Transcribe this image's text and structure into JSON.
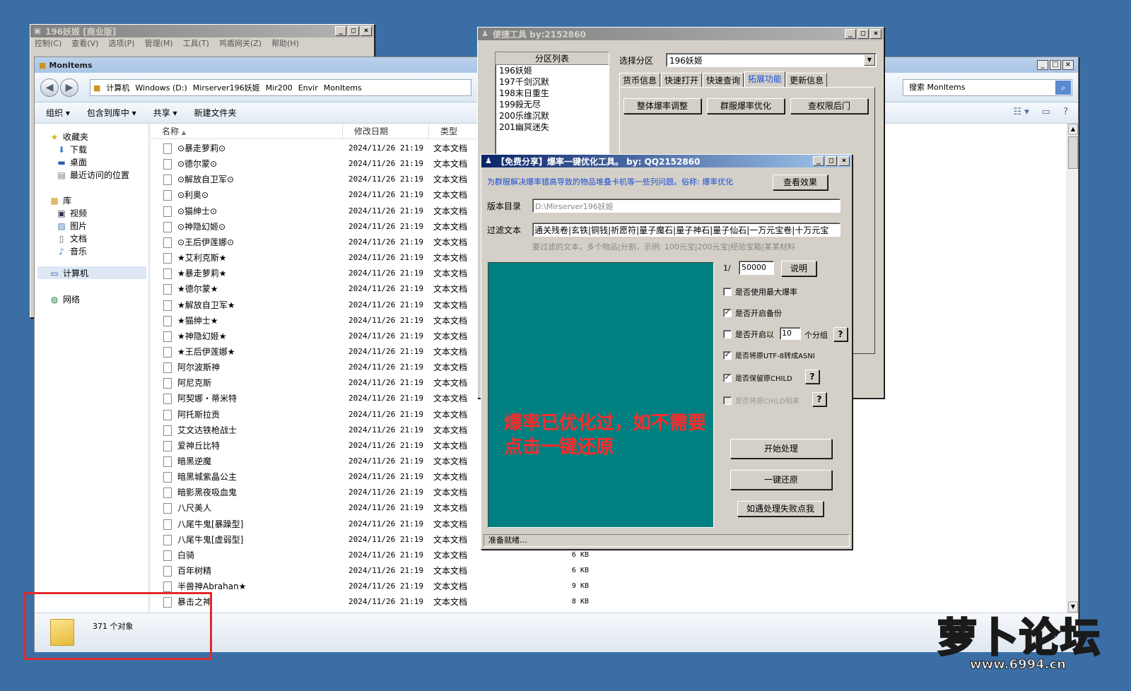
{
  "colors": {
    "desktop": "#3a6ea5",
    "teal_panel": "#008080",
    "alert_red": "#ff2a2a",
    "highlight_box": "#e02a2a",
    "tab_selected": "#1a4fd8",
    "logo_yellow": "#ffd21a"
  },
  "game_window": {
    "title": "196妖姬 [商业版]",
    "menu": [
      "控制(C)",
      "查看(V)",
      "选项(P)",
      "管理(M)",
      "工具(T)",
      "鸡盾网关(Z)",
      "帮助(H)"
    ]
  },
  "explorer": {
    "title": "MonItems",
    "breadcrumb": [
      "计算机",
      "Windows (D:)",
      "Mirserver196妖姬",
      "Mir200",
      "Envir",
      "MonItems"
    ],
    "search_placeholder": "搜索 MonItems",
    "commands": [
      "组织 ▾",
      "包含到库中 ▾",
      "共享 ▾",
      "新建文件夹"
    ],
    "nav": {
      "favorites": "收藏夹",
      "downloads": "下载",
      "desktop": "桌面",
      "recent": "最近访问的位置",
      "library": "库",
      "videos": "视频",
      "pictures": "图片",
      "documents": "文档",
      "music": "音乐",
      "computer": "计算机",
      "network": "网络"
    },
    "columns": {
      "name": "名称",
      "date": "修改日期",
      "type": "类型"
    },
    "files": [
      {
        "name": "⊙暴走萝莉⊙",
        "date": "2024/11/26 21:19",
        "type": "文本文档",
        "size": ""
      },
      {
        "name": "⊙德尔蒙⊙",
        "date": "2024/11/26 21:19",
        "type": "文本文档",
        "size": ""
      },
      {
        "name": "⊙解放自卫军⊙",
        "date": "2024/11/26 21:19",
        "type": "文本文档",
        "size": ""
      },
      {
        "name": "⊙利奥⊙",
        "date": "2024/11/26 21:19",
        "type": "文本文档",
        "size": ""
      },
      {
        "name": "⊙猫绅士⊙",
        "date": "2024/11/26 21:19",
        "type": "文本文档",
        "size": ""
      },
      {
        "name": "⊙神隐幻姬⊙",
        "date": "2024/11/26 21:19",
        "type": "文本文档",
        "size": ""
      },
      {
        "name": "⊙王后伊莲娜⊙",
        "date": "2024/11/26 21:19",
        "type": "文本文档",
        "size": ""
      },
      {
        "name": "★艾利克斯★",
        "date": "2024/11/26 21:19",
        "type": "文本文档",
        "size": ""
      },
      {
        "name": "★暴走萝莉★",
        "date": "2024/11/26 21:19",
        "type": "文本文档",
        "size": ""
      },
      {
        "name": "★德尔蒙★",
        "date": "2024/11/26 21:19",
        "type": "文本文档",
        "size": ""
      },
      {
        "name": "★解放自卫军★",
        "date": "2024/11/26 21:19",
        "type": "文本文档",
        "size": ""
      },
      {
        "name": "★猫绅士★",
        "date": "2024/11/26 21:19",
        "type": "文本文档",
        "size": ""
      },
      {
        "name": "★神隐幻姬★",
        "date": "2024/11/26 21:19",
        "type": "文本文档",
        "size": ""
      },
      {
        "name": "★王后伊莲娜★",
        "date": "2024/11/26 21:19",
        "type": "文本文档",
        "size": ""
      },
      {
        "name": "阿尔波斯神",
        "date": "2024/11/26 21:19",
        "type": "文本文档",
        "size": ""
      },
      {
        "name": "阿尼克斯",
        "date": "2024/11/26 21:19",
        "type": "文本文档",
        "size": ""
      },
      {
        "name": "阿契娜・蒂米特",
        "date": "2024/11/26 21:19",
        "type": "文本文档",
        "size": ""
      },
      {
        "name": "阿托斯拉贡",
        "date": "2024/11/26 21:19",
        "type": "文本文档",
        "size": ""
      },
      {
        "name": "艾文达铁枪战士",
        "date": "2024/11/26 21:19",
        "type": "文本文档",
        "size": ""
      },
      {
        "name": "爱神丘比特",
        "date": "2024/11/26 21:19",
        "type": "文本文档",
        "size": ""
      },
      {
        "name": "暗黑逆魔",
        "date": "2024/11/26 21:19",
        "type": "文本文档",
        "size": ""
      },
      {
        "name": "暗黑城紫晶公主",
        "date": "2024/11/26 21:19",
        "type": "文本文档",
        "size": ""
      },
      {
        "name": "暗影黑夜吸血鬼",
        "date": "2024/11/26 21:19",
        "type": "文本文档",
        "size": ""
      },
      {
        "name": "八尺美人",
        "date": "2024/11/26 21:19",
        "type": "文本文档",
        "size": ""
      },
      {
        "name": "八尾牛鬼[暴躁型]",
        "date": "2024/11/26 21:19",
        "type": "文本文档",
        "size": ""
      },
      {
        "name": "八尾牛鬼[虚弱型]",
        "date": "2024/11/26 21:19",
        "type": "文本文档",
        "size": ""
      },
      {
        "name": "白骑",
        "date": "2024/11/26 21:19",
        "type": "文本文档",
        "size": "6 KB"
      },
      {
        "name": "百年树精",
        "date": "2024/11/26 21:19",
        "type": "文本文档",
        "size": "6 KB"
      },
      {
        "name": "半兽神Abrahan★",
        "date": "2024/11/26 21:19",
        "type": "文本文档",
        "size": "9 KB"
      },
      {
        "name": "暴击之神",
        "date": "2024/11/26 21:19",
        "type": "文本文档",
        "size": "8 KB"
      }
    ],
    "status_count": "371 个对象"
  },
  "tool1": {
    "title": "便捷工具   by:2152860",
    "list_header": "分区列表",
    "partitions": [
      "196妖姬",
      "197千剑沉默",
      "198末日重生",
      "199殺无尽",
      "200乐维沉默",
      "201幽冥迷失"
    ],
    "select_label": "选择分区",
    "select_value": "196妖姬",
    "tabs": [
      "货币信息",
      "快速打开",
      "快速查询",
      "拓展功能",
      "更新信息"
    ],
    "buttons": [
      "整体爆率调整",
      "群服爆率优化",
      "查权限后门"
    ]
  },
  "tool2": {
    "title": "【免费分享】爆率一键优化工具。  by: QQ2152860",
    "desc": "为群服解决爆率错高导致的物品堆叠卡机等一些列问题。俗称: 爆率优化",
    "view_btn": "查看效果",
    "dir_label": "版本目录",
    "dir_value": "D:\\Mirserver196妖姬",
    "filter_label": "过滤文本",
    "filter_value": "通关残卷|玄铁|铜钱|祈愿符|量子魔石|量子神石|量子仙石|一万元宝卷|十万元宝",
    "filter_hint": "要过滤的文本，多个物品|分割，示例: 100元宝|200元宝|经验宝箱|某某材料",
    "ratio_prefix": "1/",
    "ratio_value": "50000",
    "explain_btn": "说明",
    "opt_max": "是否使用最大爆率",
    "opt_backup": "是否开启备份",
    "opt_group_a": "是否开启以",
    "opt_group_value": "10",
    "opt_group_b": "个分组",
    "opt_utf8": "是否将原UTF-8转成ASNI",
    "opt_child": "是否保留原CHILD",
    "opt_child_mul": "是否将原CHILD相乘",
    "q": "?",
    "alert_line1": "爆率已优化过，如不需要",
    "alert_line2": "点击一键还原",
    "start_btn": "开始处理",
    "restore_btn": "一键还原",
    "fail_btn": "如遇处理失败点我",
    "status": "准备就绪..."
  },
  "logo": {
    "text": "萝卜论坛",
    "url": "www.6994.cn"
  }
}
